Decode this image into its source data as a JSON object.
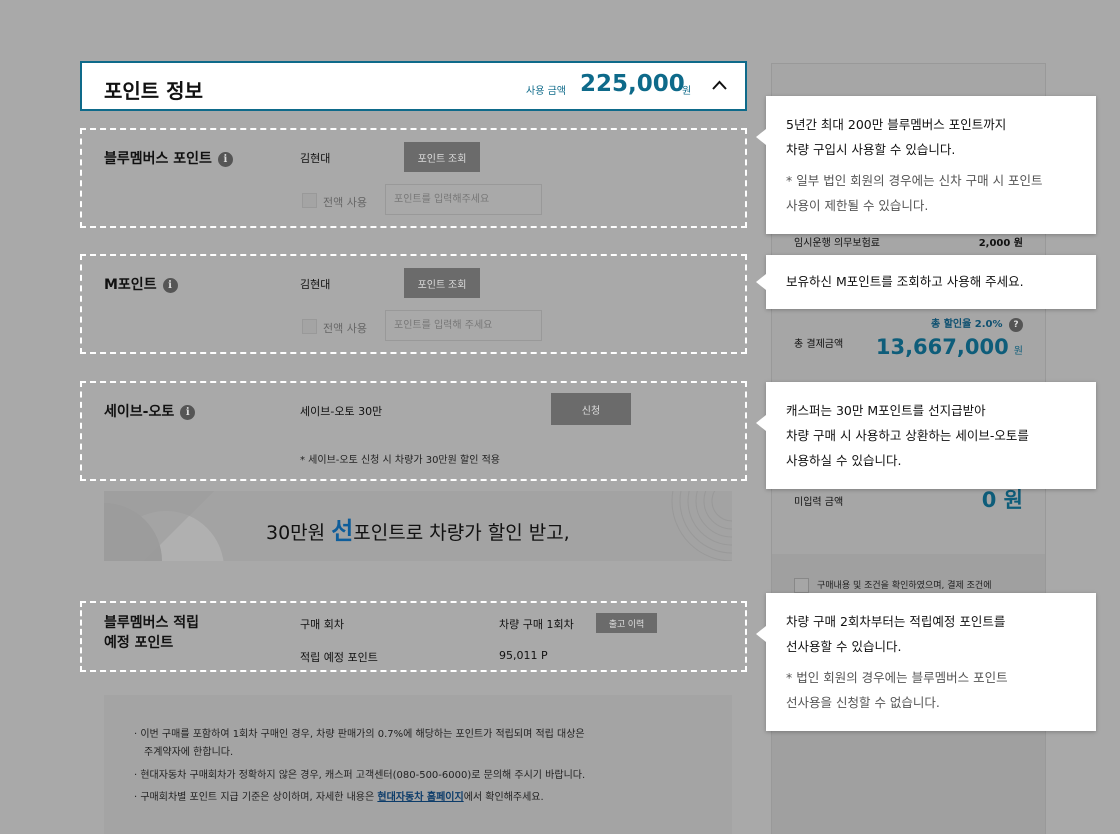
{
  "header": {
    "title": "포인트 정보",
    "used_label": "사용 금액",
    "used_amount": "225,000",
    "used_unit": "원"
  },
  "blue_members": {
    "title": "블루멤버스 포인트",
    "user_name": "김현대",
    "lookup_button": "포인트 조회",
    "full_use_label": "전액 사용",
    "input_placeholder": "포인트를 입력해주세요"
  },
  "m_point": {
    "title": "M포인트",
    "user_name": "김현대",
    "lookup_button": "포인트 조회",
    "full_use_label": "전액 사용",
    "input_placeholder": "포인트를 입력해 주세요"
  },
  "save_auto": {
    "title": "세이브-오토",
    "product": "세이브-오토 30만",
    "apply_button": "신청",
    "note": "*  세이브-오토 신청 시 차량가 30만원 할인 적용"
  },
  "banner": {
    "before": "30만원 ",
    "highlight": "선",
    "after": "포인트로 차량가 할인 받고,"
  },
  "accrual": {
    "title_line1": "블루멤버스 적립",
    "title_line2": "예정 포인트",
    "purchase_round_label": "구매 회차",
    "purchase_round_value": "차량 구매 1회차",
    "history_button": "출고 이력",
    "expected_label": "적립 예정 포인트",
    "expected_value": "95,011 P"
  },
  "notice": {
    "line1": "·  이번 구매를 포함하여 1회차 구매인 경우, 차량 판매가의 0.7%에 해당하는 포인트가 적립되며 적립 대상은",
    "line2": "주계약자에 한합니다.",
    "line3": "·  현대자동차 구매회차가 정확하지 않은 경우, 캐스퍼 고객센터(080-500-6000)로 문의해 주시기 바랍니다.",
    "line4_pre": "·  구매회차별 포인트 지급 기준은 상이하며, 자세한 내용은 ",
    "line4_link": "현대자동차 홈페이지",
    "line4_post": "에서 확인해주세요."
  },
  "summary": {
    "insurance_label": "임시운행 의무보험료",
    "insurance_value": "2,000 원",
    "discount_rate": "총 할인율 2.0%",
    "help_icon": "?",
    "total_label": "총 결제금액",
    "total_value": "13,667,000",
    "total_unit": "원",
    "unentered_label": "미입력 금액",
    "unentered_value": "0 원",
    "agree_text": "구매내용 및 조건을 확인하였으며, 결제 조건에"
  },
  "tooltips": {
    "blue_members": {
      "line1": "5년간 최대 200만 블루멤버스 포인트까지",
      "line2": "차량 구입시 사용할 수 있습니다.",
      "note1": "* 일부 법인 회원의 경우에는 신차 구매 시 포인트",
      "note2": "사용이 제한될 수 있습니다."
    },
    "m_point": {
      "line1": "보유하신 M포인트를 조회하고 사용해 주세요."
    },
    "save_auto": {
      "line1": "캐스퍼는 30만 M포인트를 선지급받아",
      "line2": "차량 구매 시 사용하고 상환하는 세이브-오토를",
      "line3": "사용하실 수 있습니다."
    },
    "accrual": {
      "line1": "차량 구매 2회차부터는 적립예정 포인트를",
      "line2": "선사용할 수 있습니다.",
      "note1": "* 법인 회원의 경우에는 블루멤버스 포인트",
      "note2": "선사용을 신청할 수 없습니다."
    }
  },
  "colors": {
    "accent": "#0e6a8a",
    "overlay": "#a9a9a9",
    "tooltip_bg": "#ffffff"
  },
  "icons": {
    "collapse": "chevron-up-icon",
    "info": "info-icon",
    "help": "question-icon"
  }
}
